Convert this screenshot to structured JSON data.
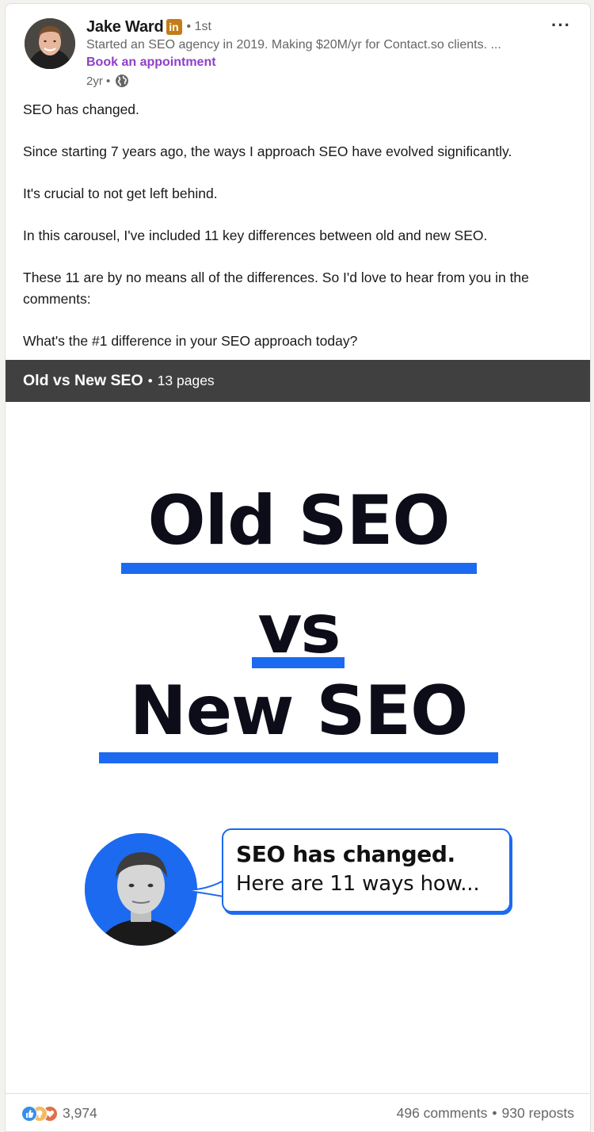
{
  "author": {
    "name": "Jake Ward",
    "badge": "in",
    "degree": "• 1st",
    "headline": "Started an SEO agency in 2019. Making $20M/yr for Contact.so clients. ...",
    "cta": "Book an appointment",
    "time": "2yr •"
  },
  "menu": {
    "more_label": "···"
  },
  "post": {
    "paragraphs": [
      "SEO has changed.",
      "Since starting 7 years ago, the ways I approach SEO have evolved significantly.",
      "It's crucial to not get left behind.",
      "In this carousel, I've included 11 key differences between old and new SEO.",
      "These 11 are by no means all of the differences. So I'd love to hear from you in the comments:",
      "What's the #1 difference in your SEO approach today?"
    ]
  },
  "document": {
    "title": "Old vs New SEO",
    "separator": "•",
    "pages": "13 pages"
  },
  "slide": {
    "line1": "Old SEO",
    "line2": "vs",
    "line3": "New SEO",
    "bubble_title": "SEO has changed.",
    "bubble_sub": "Here are 11 ways how..."
  },
  "social": {
    "reaction_count": "3,974",
    "comments": "496 comments",
    "separator": "•",
    "reposts": "930 reposts"
  },
  "colors": {
    "accent_blue": "#1c6af0",
    "cta_purple": "#8f3fc9",
    "doc_bar": "#404040",
    "badge_gold": "#c37d16"
  }
}
